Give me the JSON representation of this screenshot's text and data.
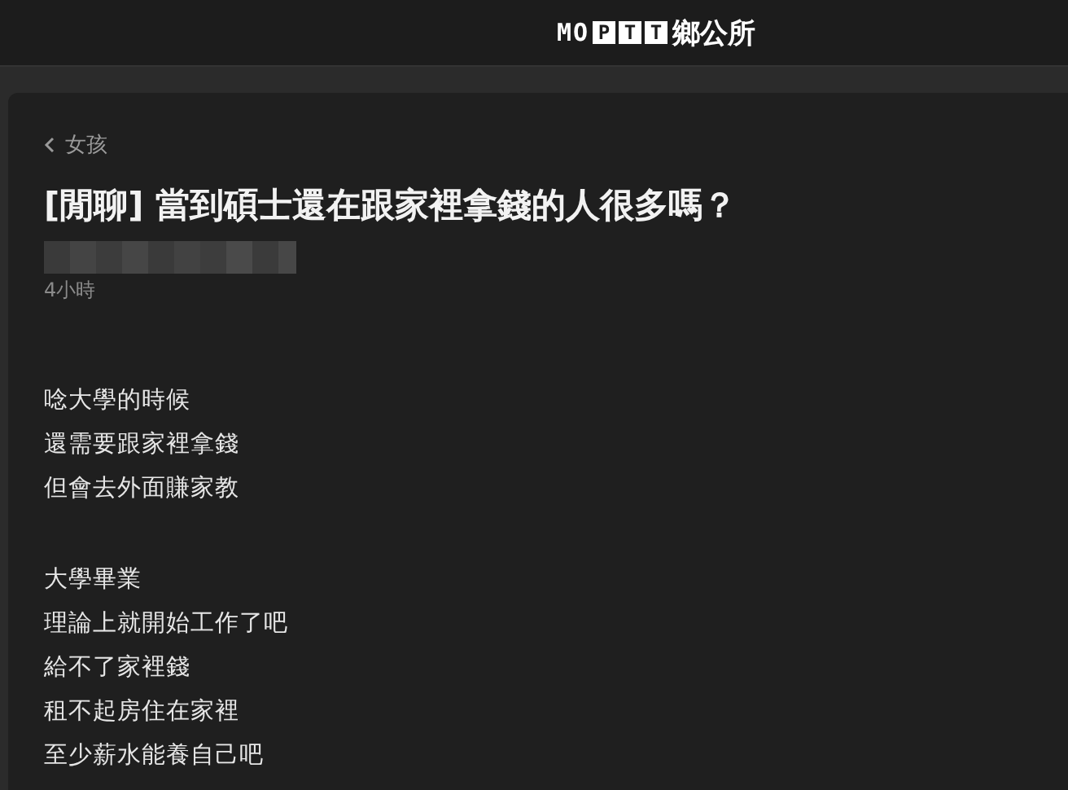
{
  "header": {
    "logo": {
      "prefix": "MO",
      "boxed": [
        "P",
        "T",
        "T"
      ],
      "suffix": "鄉公所"
    }
  },
  "post": {
    "board": "女孩",
    "title": "[閒聊] 當到碩士還在跟家裡拿錢的人很多嗎？",
    "time": "4小時",
    "paragraphs": [
      [
        "唸大學的時候",
        "還需要跟家裡拿錢",
        "但會去外面賺家教"
      ],
      [
        "大學畢業",
        "理論上就開始工作了吧",
        "給不了家裡錢",
        "租不起房住在家裡",
        "至少薪水能養自己吧"
      ]
    ]
  }
}
